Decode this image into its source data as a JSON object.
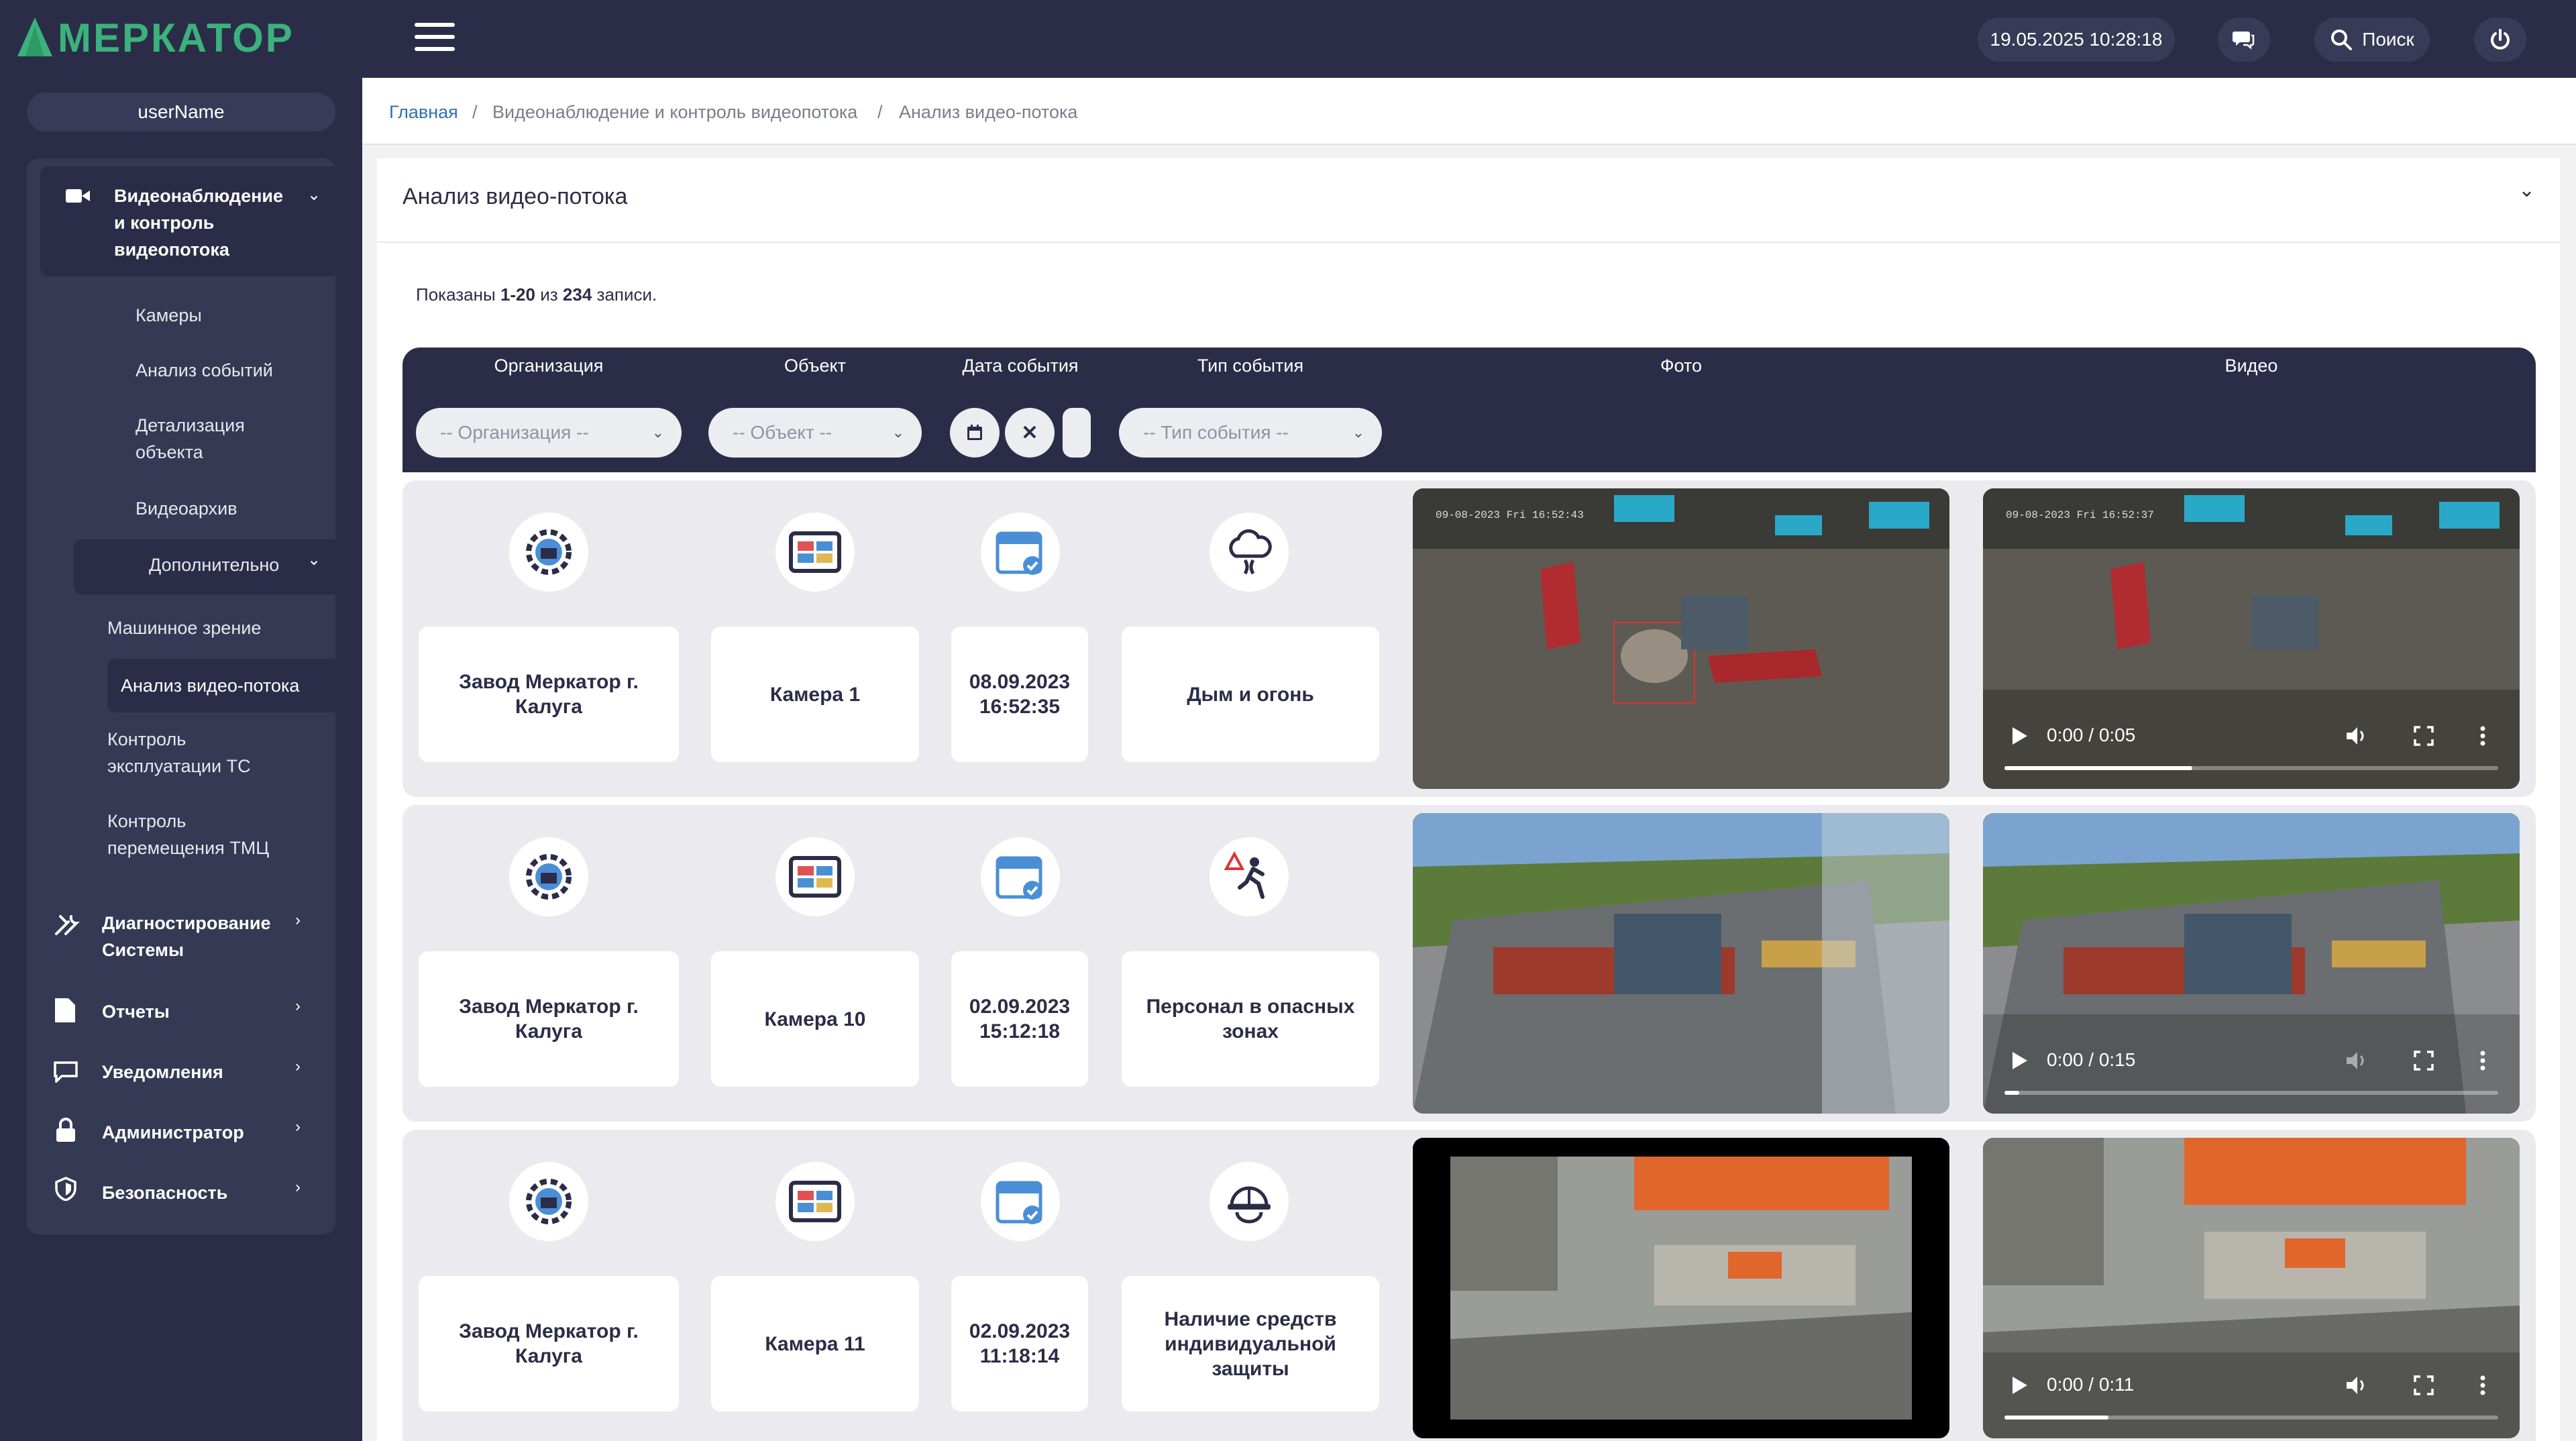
{
  "header": {
    "logo_text": "МЕРКАТОР",
    "datetime": "19.05.2025 10:28:18",
    "search_label": "Поиск"
  },
  "sidebar": {
    "username": "userName",
    "section": "Видеонаблюдение и контроль видеопотока",
    "items": [
      "Камеры",
      "Анализ событий",
      "Детализация объекта",
      "Видеоархив"
    ],
    "extra": "Дополнительно",
    "extra_items": [
      "Машинное зрение",
      "Анализ видео-потока",
      "Контроль эксплуатации ТС",
      "Контроль перемещения ТМЦ"
    ],
    "groups": [
      "Диагностирование Системы",
      "Отчеты",
      "Уведомления",
      "Администратор",
      "Безопасность"
    ]
  },
  "breadcrumb": [
    "Главная",
    "Видеонаблюдение и контроль видеопотока",
    "Анализ видео-потока"
  ],
  "panel": {
    "title": "Анализ видео-потока",
    "shown_prefix": "Показаны",
    "shown_range": "1-20",
    "shown_of": "из",
    "shown_total": "234",
    "shown_suffix": "записи."
  },
  "table": {
    "headers": [
      "Организация",
      "Объект",
      "Дата события",
      "Тип события",
      "Фото",
      "Видео"
    ],
    "filters": {
      "organization": "-- Организация --",
      "object": "-- Объект --",
      "event_type": "-- Тип события --"
    },
    "rows": [
      {
        "organization": "Завод Меркатор г. Калуга",
        "object": "Камера 1",
        "date": "08.09.2023",
        "time": "16:52:35",
        "event": "Дым и огонь",
        "event_icon": "smoke-fire-icon",
        "photo_stamp": "09-08-2023 Fri 16:52:43",
        "video_stamp": "09-08-2023 Fri 16:52:37",
        "video_time": "0:00 / 0:05",
        "video_progress": 0.38
      },
      {
        "organization": "Завод Меркатор г. Калуга",
        "object": "Камера 10",
        "date": "02.09.2023",
        "time": "15:12:18",
        "event": "Персонал в опасных зонах",
        "event_icon": "danger-zone-person-icon",
        "video_time": "0:00 / 0:15",
        "video_progress": 0.03
      },
      {
        "organization": "Завод Меркатор г. Калуга",
        "object": "Камера 11",
        "date": "02.09.2023",
        "time": "11:18:14",
        "event": "Наличие средств индивидуальной защиты",
        "event_icon": "hard-hat-icon",
        "video_time": "0:00 / 0:11",
        "video_progress": 0.21
      }
    ]
  },
  "colors": {
    "sidebar": "#2b2d48",
    "accent": "#3bb27c",
    "link": "#2e6fb6"
  }
}
